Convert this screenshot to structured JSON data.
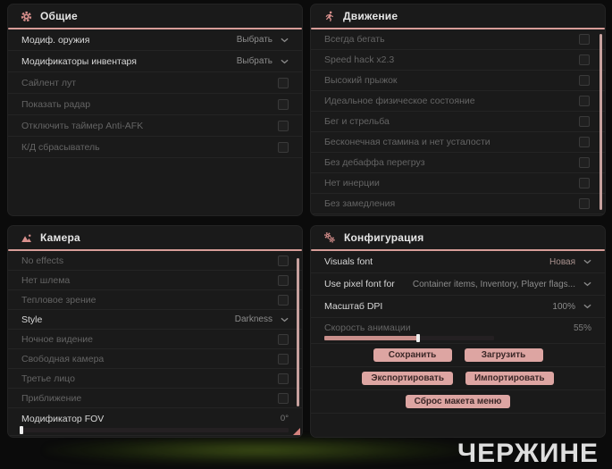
{
  "accent_color": "#d79d98",
  "watermark": "ЧЕРЖИНЕ",
  "panel_general": {
    "title": "Общие",
    "icon": "gear-icon",
    "rows": [
      {
        "label": "Модиф. оружия",
        "control": "select",
        "value": "Выбрать"
      },
      {
        "label": "Модификаторы инвентаря",
        "control": "select",
        "value": "Выбрать"
      },
      {
        "label": "Сайлент лут",
        "control": "checkbox",
        "checked": false
      },
      {
        "label": "Показать радар",
        "control": "checkbox",
        "checked": false
      },
      {
        "label": "Отключить таймер Anti-AFK",
        "control": "checkbox",
        "checked": false
      },
      {
        "label": "К/Д сбрасыватель",
        "control": "checkbox",
        "checked": false
      }
    ]
  },
  "panel_movement": {
    "title": "Движение",
    "icon": "runner-icon",
    "rows": [
      {
        "label": "Всегда бегать",
        "control": "checkbox",
        "checked": false
      },
      {
        "label": "Speed hack x2.3",
        "control": "checkbox",
        "checked": false
      },
      {
        "label": "Высокий прыжок",
        "control": "checkbox",
        "checked": false
      },
      {
        "label": "Идеальное физическое состояние",
        "control": "checkbox",
        "checked": false
      },
      {
        "label": "Бег и стрельба",
        "control": "checkbox",
        "checked": false
      },
      {
        "label": "Бесконечная стамина и нет усталости",
        "control": "checkbox",
        "checked": false
      },
      {
        "label": "Без дебаффа перегруз",
        "control": "checkbox",
        "checked": false
      },
      {
        "label": "Нет инерции",
        "control": "checkbox",
        "checked": false
      },
      {
        "label": "Без замедления",
        "control": "checkbox",
        "checked": false
      }
    ]
  },
  "panel_camera": {
    "title": "Камера",
    "icon": "image-icon",
    "rows": [
      {
        "label": "No effects",
        "control": "checkbox",
        "checked": false
      },
      {
        "label": "Нет шлема",
        "control": "checkbox",
        "checked": false
      },
      {
        "label": "Тепловое зрение",
        "control": "checkbox",
        "checked": false
      },
      {
        "label": "Style",
        "control": "select",
        "value": "Darkness"
      },
      {
        "label": "Ночное видение",
        "control": "checkbox",
        "checked": false
      },
      {
        "label": "Свободная камера",
        "control": "checkbox",
        "checked": false
      },
      {
        "label": "Третье лицо",
        "control": "checkbox",
        "checked": false
      },
      {
        "label": "Приближение",
        "control": "checkbox",
        "checked": false
      }
    ],
    "fov_slider": {
      "label": "Модификатор FOV",
      "value": "0°",
      "percent": 0
    }
  },
  "panel_config": {
    "title": "Конфигурация",
    "icon": "gears-icon",
    "selects": [
      {
        "label": "Visuals font",
        "value": "Новая"
      },
      {
        "label": "Use pixel font for",
        "value": "Container items, Inventory, Player flags..."
      },
      {
        "label": "Масштаб DPI",
        "value": "100%"
      }
    ],
    "anim_slider": {
      "label": "Скорость анимации",
      "value": "55%",
      "percent": 55
    },
    "buttons": {
      "save": "Сохранить",
      "load": "Загрузить",
      "export": "Экспортировать",
      "import": "Импортировать",
      "reset": "Сброс макета меню"
    }
  }
}
